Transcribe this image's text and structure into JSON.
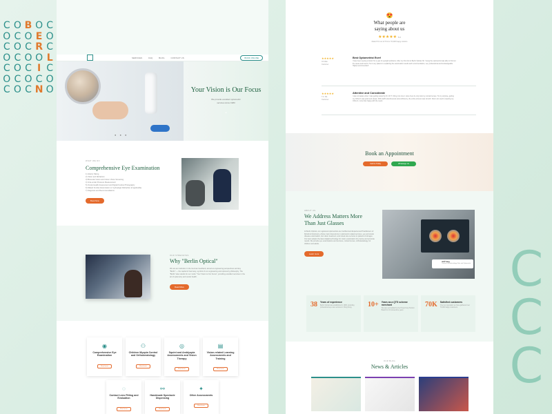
{
  "logo": {
    "grid": [
      "C",
      "O",
      "B",
      "O",
      "C",
      "O",
      "O",
      "C",
      "O",
      "E",
      "O",
      "C",
      "C",
      "O",
      "C",
      "R",
      "C",
      "O",
      "O",
      "C",
      "O",
      "O",
      "L",
      "O",
      "C",
      "O",
      "C",
      "I",
      "C",
      "O",
      "O",
      "C",
      "O",
      "C",
      "O",
      "O",
      "C",
      "O",
      "C",
      "N",
      "O",
      "O"
    ]
  },
  "left_page": {
    "nav": {
      "items": [
        "SERVICES",
        "FAQ",
        "BLOG",
        "CONTACT US"
      ],
      "cta": "BOOK ONLINE"
    },
    "hero": {
      "title": "Your Vision is Our Focus",
      "subtitle": "We provide excellent optometric services since 1983"
    },
    "exam": {
      "eyebrow": "WHAT WE DO",
      "title": "Comprehensive Eye Examination",
      "list": [
        "1) History Taking",
        "2) Vision and Refraction",
        "3) Binocular Vision and Colour Vision Screening",
        "4) Intra-ocular Pressure Measurement",
        "5) Ocular Health Assessment and Digital Fundus Photography",
        "6) Dilated Fundus Examination or Cycloplegic Refraction (if applicable)",
        "7) Diagnosis and Recommendations"
      ],
      "button": "Book Now"
    },
    "why": {
      "eyebrow": "OUR STRENGTHS",
      "title": "Why \"Berlin Optical\"",
      "body": "We are an institution in the German heartland, aimed at engineering perspectives and key \"Berlin\" — the capital of Germany, symbol of our engineering and optometry philosophy. The \"Berlin\" also stands for our motto \"Your Vision is Our Focus\", providing excellent services in the art of optometry and ocular health.",
      "button": "Read More"
    },
    "services": [
      {
        "icon": "eye-exam-icon",
        "label": "Comprehensive Eye Examination",
        "button": "Read more"
      },
      {
        "icon": "myopia-icon",
        "label": "Children Myopia Control and Orthokeratology",
        "button": "Read more"
      },
      {
        "icon": "squint-icon",
        "label": "Squint and Amblyopia Assessments and Vision Therapy",
        "button": "Read more"
      },
      {
        "icon": "learning-icon",
        "label": "Vision-related Learning Assessments and Training",
        "button": "Read more"
      },
      {
        "icon": "contact-lens-icon",
        "label": "Contact Lens Fitting and Evaluation",
        "button": "Read more"
      },
      {
        "icon": "spectacle-icon",
        "label": "Handmade Spectacle Dispensing",
        "button": "Read more"
      },
      {
        "icon": "other-icon",
        "label": "Other Assessments",
        "button": "Read more"
      }
    ]
  },
  "right_page": {
    "testimonials": {
      "emoji": "😍",
      "title": "What people are saying about us",
      "rating": "5.0",
      "subtitle": "Rated 5.0 out of 5 from 70,000 happy visitors",
      "reviews": [
        {
          "stars": "★★★★★",
          "author": "CK Wan",
          "source": "Customer",
          "title": "Best Optometrist Ever!",
          "body": "I have been seeing a doctor for a year of eyesight problems. After my first visit to Berlin Optical, Mr. Yeung the optometrist was able to find out the cause and treat it. He is very patient in explaining the examination results and recommendation, very professional and knowledgeable. Highly recommended!"
        },
        {
          "stars": "★★★★★",
          "author": "T.C. Ma",
          "source": "Customer",
          "title": "Attentive and Considerate",
          "body": "I was not aware when I was getting tested by Dr. W. P. Ching, but once I came here he only took my contact lenses. To my surprise, getting my Ortho-K was quick and simple. With staff's attentiveness and proficiency, the entire process was smooth. Now I am used to wearing my Ortho-K, more than happy with the result."
        }
      ]
    },
    "appointment": {
      "title": "Book an Appointment",
      "call": "Call Us Today",
      "whatsapp": "WhatsApp Us"
    },
    "about": {
      "eyebrow": "ABOUT US",
      "title": "We Address Matters More Than Just Glasses",
      "body": "At Berlin Optical, our registered optometrists are Certified and Experienced Practitioners of Rehab & Optometry, whose main interests lie in optometric related services, eye and ocular disease examination, low vision treatment, and visual care services to patients of all ages. Our team adopts the latest digital technology for vision examination for precise and accurate results. We provide eye examinations and services, contact lenses, orthokeratology, for children and adults.",
      "button": "Learn more",
      "tag": {
        "name": "Jeff Yung",
        "role": "Certified Orthokeratology Fitter and Optometrist"
      }
    },
    "stats": [
      {
        "num": "38",
        "label": "Years of experience",
        "desc": "Berlin Optical was established in 1983, providing professional eye care services in Hong Kong."
      },
      {
        "num": "10+",
        "label": "Years as a QTS scheme merchant",
        "desc": "We were accredited by the Hong Kong Tourism Board for 10 consecutive years."
      },
      {
        "num": "70K",
        "label": "Satisfied customers",
        "desc": "Over our operation we have gathered over 70,000 happy customers."
      }
    ],
    "news": {
      "eyebrow": "OUR BLOG",
      "title": "News & Articles"
    }
  },
  "colors": {
    "primary": "#1e5f3f",
    "accent": "#e46a2c",
    "teal": "#2b8f8a",
    "whatsapp": "#2fa84f"
  }
}
